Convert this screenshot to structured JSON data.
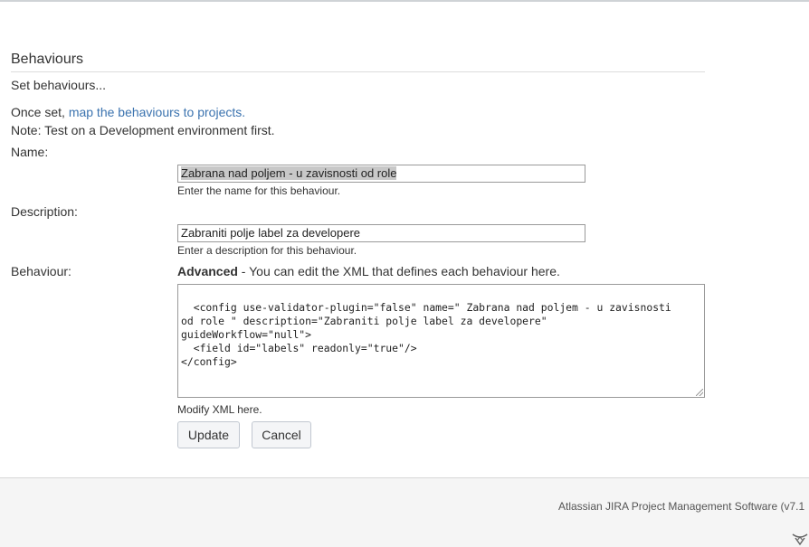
{
  "page": {
    "section_title": "Behaviours",
    "subtitle": "Set behaviours...",
    "once_set_prefix": "Once set, ",
    "map_link": "map the behaviours to projects.",
    "note": "Note: Test on a Development environment first."
  },
  "form": {
    "name_label": "Name:",
    "name_value": "Zabrana nad poljem - u zavisnosti od role",
    "name_hint": "Enter the name for this behaviour.",
    "description_label": "Description:",
    "description_value": "Zabraniti polje label za developere",
    "description_hint": "Enter a description for this behaviour.",
    "behaviour_label": "Behaviour:",
    "advanced_bold": "Advanced",
    "advanced_text": " - You can edit the XML that defines each behaviour here.",
    "xml_value": "<config use-validator-plugin=\"false\" name=\" Zabrana nad poljem - u zavisnosti\nod role \" description=\"Zabraniti polje label za developere\"\nguideWorkflow=\"null\">\n  <field id=\"labels\" readonly=\"true\"/>\n</config>",
    "xml_hint": "Modify XML here."
  },
  "buttons": {
    "update": "Update",
    "cancel": "Cancel"
  },
  "footer": {
    "text": "Atlassian JIRA Project Management Software (v7.1",
    "logo_icon": "atlassian-logo-icon"
  },
  "colors": {
    "link": "#3b73af",
    "footer_bg": "#f5f5f5"
  }
}
